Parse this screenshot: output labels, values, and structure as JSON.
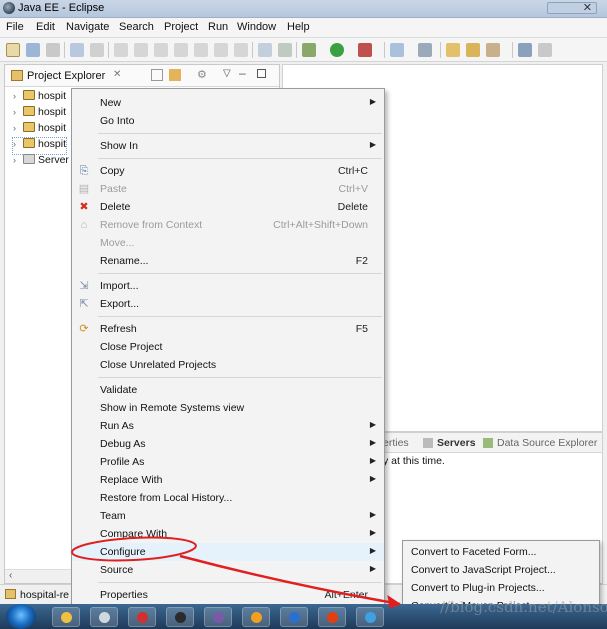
{
  "window": {
    "title": "Java EE - Eclipse"
  },
  "menubar": [
    "File",
    "Edit",
    "Navigate",
    "Search",
    "Project",
    "Run",
    "Window",
    "Help"
  ],
  "explorer": {
    "tab_label": "Project Explorer",
    "items": [
      "hospit",
      "hospit",
      "hospit",
      "hospit",
      "Server"
    ]
  },
  "context_menu": {
    "items": [
      {
        "label": "New",
        "accel": "",
        "submenu": true,
        "disabled": false,
        "icon": ""
      },
      {
        "label": "Go Into",
        "accel": "",
        "submenu": false,
        "disabled": false,
        "icon": ""
      },
      {
        "sep": true
      },
      {
        "label": "Show In",
        "accel": "",
        "submenu": true,
        "disabled": false,
        "icon": ""
      },
      {
        "sep": true
      },
      {
        "label": "Copy",
        "accel": "Ctrl+C",
        "submenu": false,
        "disabled": false,
        "icon": "copy-icon"
      },
      {
        "label": "Paste",
        "accel": "Ctrl+V",
        "submenu": false,
        "disabled": true,
        "icon": "paste-icon"
      },
      {
        "label": "Delete",
        "accel": "Delete",
        "submenu": false,
        "disabled": false,
        "icon": "delete-icon"
      },
      {
        "label": "Remove from Context",
        "accel": "Ctrl+Alt+Shift+Down",
        "submenu": false,
        "disabled": true,
        "icon": "remove-context-icon"
      },
      {
        "label": "Move...",
        "accel": "",
        "submenu": false,
        "disabled": true,
        "icon": ""
      },
      {
        "label": "Rename...",
        "accel": "F2",
        "submenu": false,
        "disabled": false,
        "icon": ""
      },
      {
        "sep": true
      },
      {
        "label": "Import...",
        "accel": "",
        "submenu": false,
        "disabled": false,
        "icon": "import-icon"
      },
      {
        "label": "Export...",
        "accel": "",
        "submenu": false,
        "disabled": false,
        "icon": "export-icon"
      },
      {
        "sep": true
      },
      {
        "label": "Refresh",
        "accel": "F5",
        "submenu": false,
        "disabled": false,
        "icon": "refresh-icon"
      },
      {
        "label": "Close Project",
        "accel": "",
        "submenu": false,
        "disabled": false,
        "icon": ""
      },
      {
        "label": "Close Unrelated Projects",
        "accel": "",
        "submenu": false,
        "disabled": false,
        "icon": ""
      },
      {
        "sep": true
      },
      {
        "label": "Validate",
        "accel": "",
        "submenu": false,
        "disabled": false,
        "icon": ""
      },
      {
        "label": "Show in Remote Systems view",
        "accel": "",
        "submenu": false,
        "disabled": false,
        "icon": ""
      },
      {
        "label": "Run As",
        "accel": "",
        "submenu": true,
        "disabled": false,
        "icon": ""
      },
      {
        "label": "Debug As",
        "accel": "",
        "submenu": true,
        "disabled": false,
        "icon": ""
      },
      {
        "label": "Profile As",
        "accel": "",
        "submenu": true,
        "disabled": false,
        "icon": ""
      },
      {
        "label": "Replace With",
        "accel": "",
        "submenu": true,
        "disabled": false,
        "icon": ""
      },
      {
        "label": "Restore from Local History...",
        "accel": "",
        "submenu": false,
        "disabled": false,
        "icon": ""
      },
      {
        "label": "Team",
        "accel": "",
        "submenu": true,
        "disabled": false,
        "icon": ""
      },
      {
        "label": "Compare With",
        "accel": "",
        "submenu": true,
        "disabled": false,
        "icon": ""
      },
      {
        "label": "Configure",
        "accel": "",
        "submenu": true,
        "disabled": false,
        "icon": "",
        "hover": true
      },
      {
        "label": "Source",
        "accel": "",
        "submenu": true,
        "disabled": false,
        "icon": ""
      },
      {
        "sep": true
      },
      {
        "label": "Properties",
        "accel": "Alt+Enter",
        "submenu": false,
        "disabled": false,
        "icon": ""
      }
    ]
  },
  "submenu": {
    "items": [
      "Convert to Faceted Form...",
      "Convert to JavaScript Project...",
      "Convert to Plug-in Projects...",
      "Convert to Maven Project"
    ]
  },
  "servers_panel": {
    "tabs": [
      "erties",
      "Servers",
      "Data Source Explorer"
    ],
    "message": "y at this time."
  },
  "statusline": {
    "project": "hospital-re"
  },
  "watermark": "//blog.csdn.net/AlonsoK",
  "colors": {
    "annotation": "#e02020",
    "hover": "#e5f1fb"
  }
}
